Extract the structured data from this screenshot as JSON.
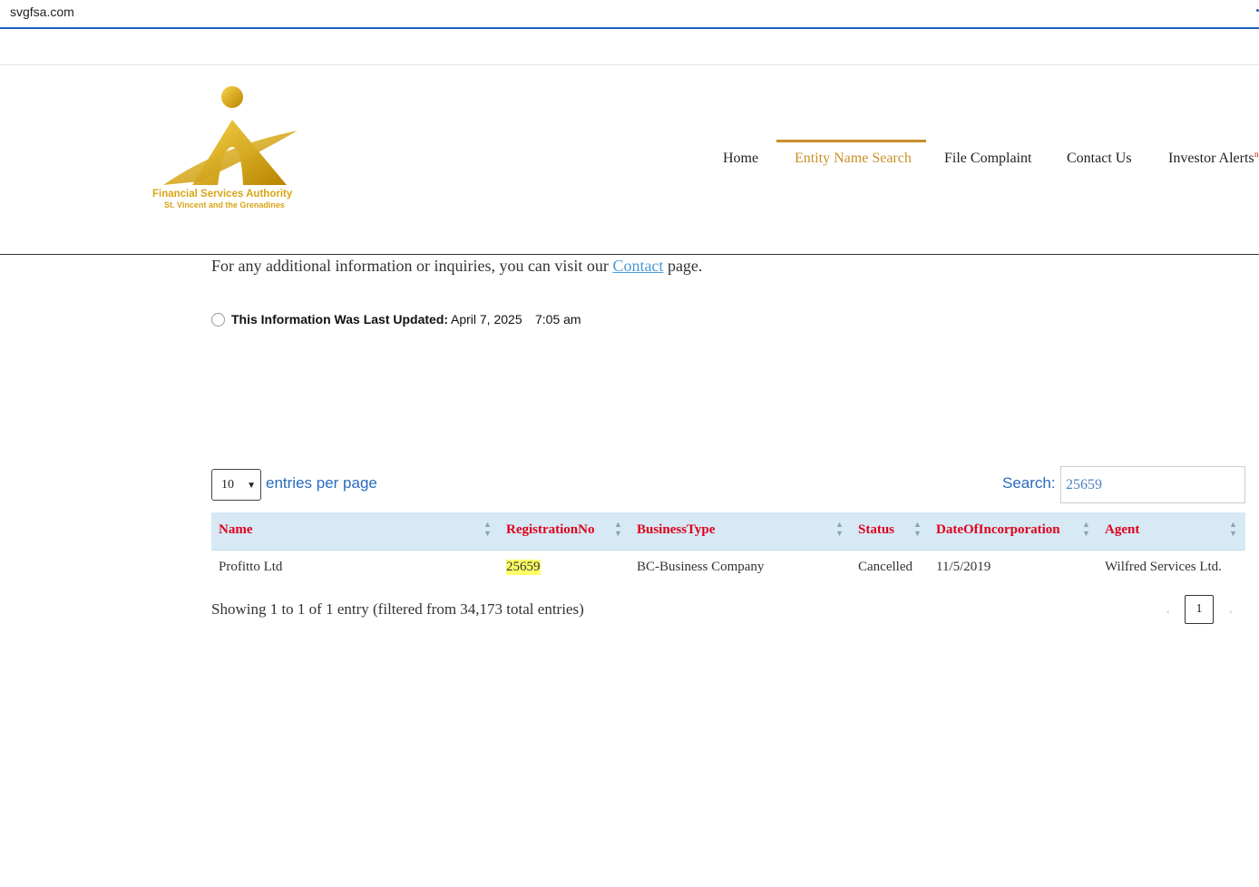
{
  "browser": {
    "url": "svgfsa.com"
  },
  "logo": {
    "line1": "Financial Services Authority",
    "line2": "St. Vincent and the Grenadines",
    "colors": {
      "gold": "#d9a516"
    }
  },
  "nav": {
    "items": [
      {
        "label": "Home"
      },
      {
        "label": "Entity Name Search"
      },
      {
        "label": "File Complaint"
      },
      {
        "label": "Contact Us"
      },
      {
        "label": "Investor Alerts"
      }
    ],
    "active_index": 1,
    "active_color": "#c8902a"
  },
  "info": {
    "prefix": "For any additional information or inquiries, you can visit our",
    "link": "Contact",
    "suffix": "page."
  },
  "updated": {
    "label": "This Information Was Last Updated:",
    "date": "April 7, 2025",
    "time": "7:05 am"
  },
  "table_controls": {
    "entries_value": "10",
    "entries_label": "entries per page",
    "search_label": "Search:",
    "search_value": "25659"
  },
  "table": {
    "headers": [
      "Name",
      "RegistrationNo",
      "BusinessType",
      "Status",
      "DateOfIncorporation",
      "Agent"
    ],
    "rows": [
      [
        "Profitto Ltd",
        "25659",
        "BC-Business Company",
        "Cancelled",
        "11/5/2019",
        "Wilfred Services Ltd."
      ]
    ],
    "header_color": "#e0001a",
    "header_bg": "#d6e9f5"
  },
  "footer": {
    "showing": "Showing 1 to 1 of 1 entry (filtered from 34,173 total entries)",
    "prev": "‹",
    "page": "1",
    "next": "›"
  }
}
